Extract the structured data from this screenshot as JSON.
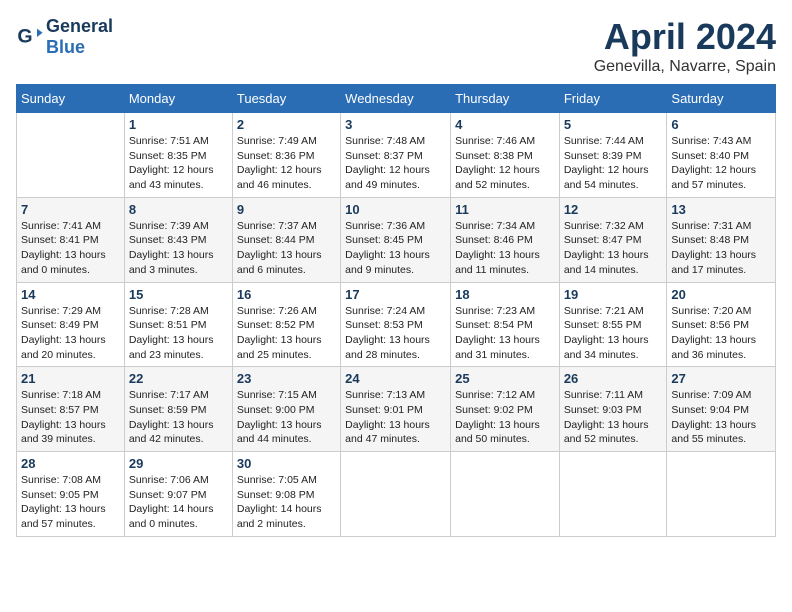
{
  "header": {
    "logo_general": "General",
    "logo_blue": "Blue",
    "month_title": "April 2024",
    "location": "Genevilla, Navarre, Spain"
  },
  "weekdays": [
    "Sunday",
    "Monday",
    "Tuesday",
    "Wednesday",
    "Thursday",
    "Friday",
    "Saturday"
  ],
  "weeks": [
    [
      {
        "day": "",
        "info": ""
      },
      {
        "day": "1",
        "info": "Sunrise: 7:51 AM\nSunset: 8:35 PM\nDaylight: 12 hours\nand 43 minutes."
      },
      {
        "day": "2",
        "info": "Sunrise: 7:49 AM\nSunset: 8:36 PM\nDaylight: 12 hours\nand 46 minutes."
      },
      {
        "day": "3",
        "info": "Sunrise: 7:48 AM\nSunset: 8:37 PM\nDaylight: 12 hours\nand 49 minutes."
      },
      {
        "day": "4",
        "info": "Sunrise: 7:46 AM\nSunset: 8:38 PM\nDaylight: 12 hours\nand 52 minutes."
      },
      {
        "day": "5",
        "info": "Sunrise: 7:44 AM\nSunset: 8:39 PM\nDaylight: 12 hours\nand 54 minutes."
      },
      {
        "day": "6",
        "info": "Sunrise: 7:43 AM\nSunset: 8:40 PM\nDaylight: 12 hours\nand 57 minutes."
      }
    ],
    [
      {
        "day": "7",
        "info": "Sunrise: 7:41 AM\nSunset: 8:41 PM\nDaylight: 13 hours\nand 0 minutes."
      },
      {
        "day": "8",
        "info": "Sunrise: 7:39 AM\nSunset: 8:43 PM\nDaylight: 13 hours\nand 3 minutes."
      },
      {
        "day": "9",
        "info": "Sunrise: 7:37 AM\nSunset: 8:44 PM\nDaylight: 13 hours\nand 6 minutes."
      },
      {
        "day": "10",
        "info": "Sunrise: 7:36 AM\nSunset: 8:45 PM\nDaylight: 13 hours\nand 9 minutes."
      },
      {
        "day": "11",
        "info": "Sunrise: 7:34 AM\nSunset: 8:46 PM\nDaylight: 13 hours\nand 11 minutes."
      },
      {
        "day": "12",
        "info": "Sunrise: 7:32 AM\nSunset: 8:47 PM\nDaylight: 13 hours\nand 14 minutes."
      },
      {
        "day": "13",
        "info": "Sunrise: 7:31 AM\nSunset: 8:48 PM\nDaylight: 13 hours\nand 17 minutes."
      }
    ],
    [
      {
        "day": "14",
        "info": "Sunrise: 7:29 AM\nSunset: 8:49 PM\nDaylight: 13 hours\nand 20 minutes."
      },
      {
        "day": "15",
        "info": "Sunrise: 7:28 AM\nSunset: 8:51 PM\nDaylight: 13 hours\nand 23 minutes."
      },
      {
        "day": "16",
        "info": "Sunrise: 7:26 AM\nSunset: 8:52 PM\nDaylight: 13 hours\nand 25 minutes."
      },
      {
        "day": "17",
        "info": "Sunrise: 7:24 AM\nSunset: 8:53 PM\nDaylight: 13 hours\nand 28 minutes."
      },
      {
        "day": "18",
        "info": "Sunrise: 7:23 AM\nSunset: 8:54 PM\nDaylight: 13 hours\nand 31 minutes."
      },
      {
        "day": "19",
        "info": "Sunrise: 7:21 AM\nSunset: 8:55 PM\nDaylight: 13 hours\nand 34 minutes."
      },
      {
        "day": "20",
        "info": "Sunrise: 7:20 AM\nSunset: 8:56 PM\nDaylight: 13 hours\nand 36 minutes."
      }
    ],
    [
      {
        "day": "21",
        "info": "Sunrise: 7:18 AM\nSunset: 8:57 PM\nDaylight: 13 hours\nand 39 minutes."
      },
      {
        "day": "22",
        "info": "Sunrise: 7:17 AM\nSunset: 8:59 PM\nDaylight: 13 hours\nand 42 minutes."
      },
      {
        "day": "23",
        "info": "Sunrise: 7:15 AM\nSunset: 9:00 PM\nDaylight: 13 hours\nand 44 minutes."
      },
      {
        "day": "24",
        "info": "Sunrise: 7:13 AM\nSunset: 9:01 PM\nDaylight: 13 hours\nand 47 minutes."
      },
      {
        "day": "25",
        "info": "Sunrise: 7:12 AM\nSunset: 9:02 PM\nDaylight: 13 hours\nand 50 minutes."
      },
      {
        "day": "26",
        "info": "Sunrise: 7:11 AM\nSunset: 9:03 PM\nDaylight: 13 hours\nand 52 minutes."
      },
      {
        "day": "27",
        "info": "Sunrise: 7:09 AM\nSunset: 9:04 PM\nDaylight: 13 hours\nand 55 minutes."
      }
    ],
    [
      {
        "day": "28",
        "info": "Sunrise: 7:08 AM\nSunset: 9:05 PM\nDaylight: 13 hours\nand 57 minutes."
      },
      {
        "day": "29",
        "info": "Sunrise: 7:06 AM\nSunset: 9:07 PM\nDaylight: 14 hours\nand 0 minutes."
      },
      {
        "day": "30",
        "info": "Sunrise: 7:05 AM\nSunset: 9:08 PM\nDaylight: 14 hours\nand 2 minutes."
      },
      {
        "day": "",
        "info": ""
      },
      {
        "day": "",
        "info": ""
      },
      {
        "day": "",
        "info": ""
      },
      {
        "day": "",
        "info": ""
      }
    ]
  ]
}
